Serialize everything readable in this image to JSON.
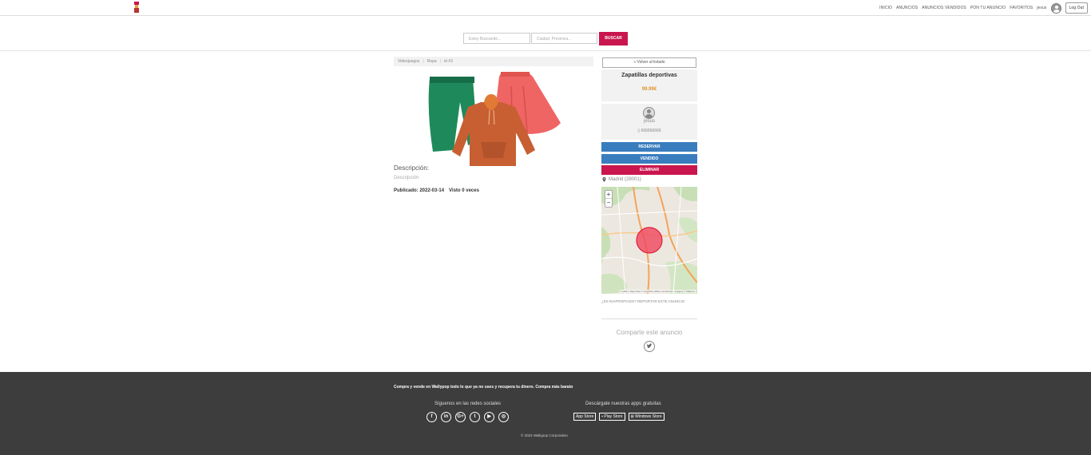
{
  "nav": {
    "links": [
      "INICIO",
      "ANUNCIOS",
      "ANUNCIOS VENDIDOS",
      "PON TU ANUNCIO",
      "FAVORITOS"
    ],
    "username": "jesus",
    "logout_label": "Log Out"
  },
  "search": {
    "keyword_placeholder": "Estoy Buscando...",
    "location_placeholder": "Ciudad, Provincia...",
    "button_label": "BUSCAR"
  },
  "breadcrumb": {
    "category": "Videojuegos",
    "subcategory": "Ropa",
    "id_label": "id #3"
  },
  "product": {
    "description_title": "Descripción:",
    "description_text": "Descripción",
    "published": "Publicado: 2022-03-14",
    "views": "Visto 0 veces",
    "title": "Zapatillas deportivas",
    "price": "99.99€"
  },
  "sidebar": {
    "back_label": "« Volver al listado",
    "seller_name": "jesus",
    "seller_phone": "666666666",
    "reserve_label": "RESERVAR",
    "sold_label": "VENDIDO",
    "delete_label": "ELIMINAR",
    "location": "Madrid (28001)",
    "map_attribution": "Leaflet | Map data © OpenStreetMap contributors, Imagery © Mapbox",
    "report_label": "¿Es inapropiado? Reportar este anuncio",
    "share_label": "Comparte este anuncio"
  },
  "footer": {
    "tagline": "Compra y vende en Wallypop todo lo que ya no uses y recupera tu dinero. Compra más barato",
    "social_title": "Síguenos en las redes sociales",
    "apps_title": "Descárgate nuestras apps gratuitas",
    "apps": [
      "App Store",
      "Play Store",
      "Windows Store"
    ],
    "copyright": "© 2022 Wallypop Corporation"
  },
  "colors": {
    "brand": "#c9164f",
    "blue": "#3a7dbf",
    "price": "#e0912b",
    "footer": "#3d3d3d"
  },
  "icons": [
    "logo-icon",
    "user-avatar-icon",
    "map-pin-icon",
    "twitter-icon",
    "facebook-icon",
    "linkedin-icon",
    "google-plus-icon",
    "youtube-icon",
    "instagram-icon",
    "apple-icon",
    "android-icon",
    "windows-icon"
  ]
}
